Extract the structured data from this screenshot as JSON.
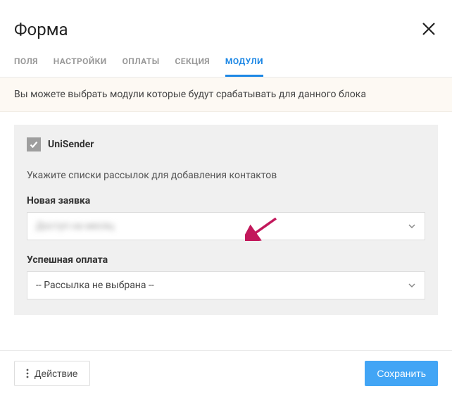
{
  "header": {
    "title": "Форма"
  },
  "tabs": [
    {
      "label": "ПОЛЯ",
      "active": false
    },
    {
      "label": "НАСТРОЙКИ",
      "active": false
    },
    {
      "label": "ОПЛАТЫ",
      "active": false
    },
    {
      "label": "СЕКЦИЯ",
      "active": false
    },
    {
      "label": "МОДУЛИ",
      "active": true
    }
  ],
  "info_text": "Вы можете выбрать модули которые будут срабатывать для данного блока",
  "module": {
    "name": "UniSender",
    "checked": true,
    "hint": "Укажите списки рассылок для добавления контактов",
    "fields": [
      {
        "label": "Новая заявка",
        "value": "Доступ на месяц",
        "blurred": true
      },
      {
        "label": "Успешная оплата",
        "value": "-- Рассылка не выбрана --",
        "blurred": false
      }
    ]
  },
  "footer": {
    "action_label": "Действие",
    "save_label": "Сохранить"
  }
}
